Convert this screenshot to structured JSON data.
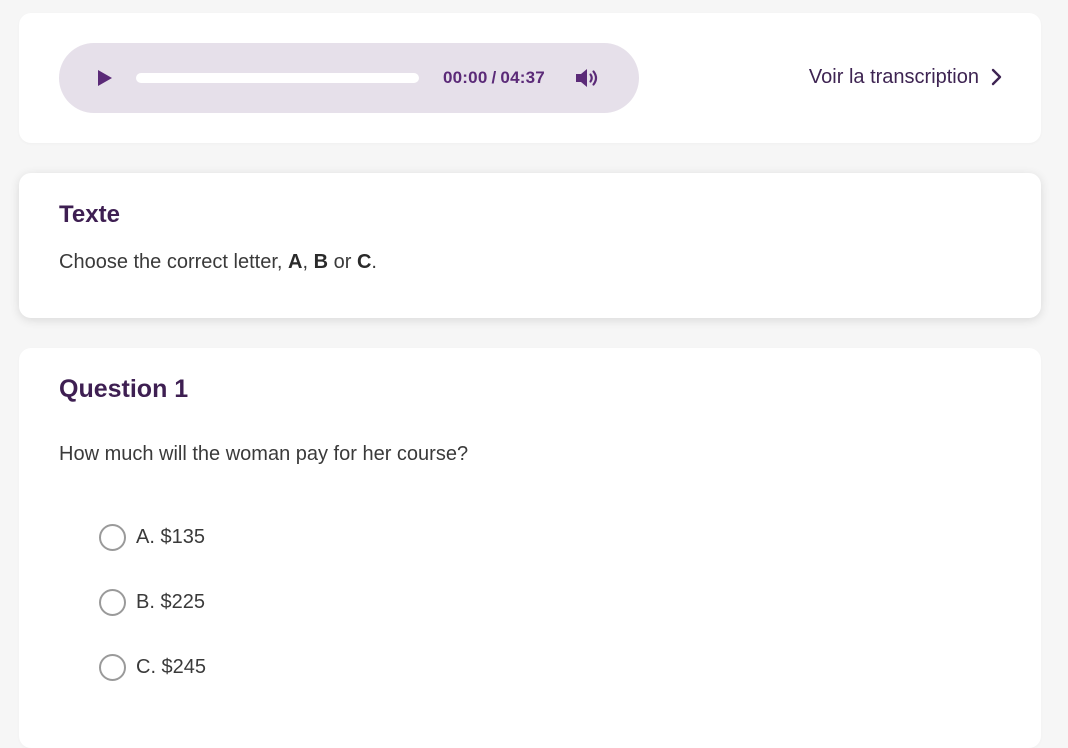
{
  "audio": {
    "current_time": "00:00",
    "separator": "/",
    "duration": "04:37",
    "progress": 0,
    "play_icon": "play-icon",
    "volume_icon": "volume-icon"
  },
  "transcript": {
    "label": "Voir la transcription",
    "icon": "chevron-right-icon"
  },
  "texte": {
    "heading": "Texte",
    "instruction_prefix": "Choose the correct letter, ",
    "letter_a": "A",
    "comma": ", ",
    "letter_b": "B",
    "or_word": " or ",
    "letter_c": "C",
    "period": "."
  },
  "question": {
    "heading": "Question 1",
    "prompt": "How much will the woman pay for her course?",
    "options": [
      {
        "label": "A. $135",
        "selected": false
      },
      {
        "label": "B. $225",
        "selected": false
      },
      {
        "label": "C. $245",
        "selected": false
      }
    ]
  },
  "colors": {
    "accent": "#5b2a78",
    "heading": "#3e1f52",
    "player_bg": "#e6e0ea",
    "page_bg": "#f6f6f6"
  }
}
